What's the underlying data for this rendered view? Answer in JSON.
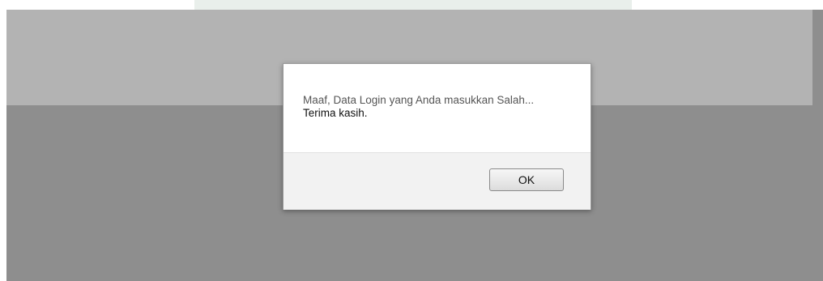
{
  "alert": {
    "message_line1": "Maaf, Data Login yang Anda masukkan Salah...",
    "message_line2": "Terima kasih.",
    "ok_label": "OK"
  },
  "colors": {
    "backdrop_dark": "#8e8e8e",
    "backdrop_light": "#b3b3b3",
    "watermark": "#a9bfb0",
    "dialog_footer": "#f2f2f2"
  }
}
